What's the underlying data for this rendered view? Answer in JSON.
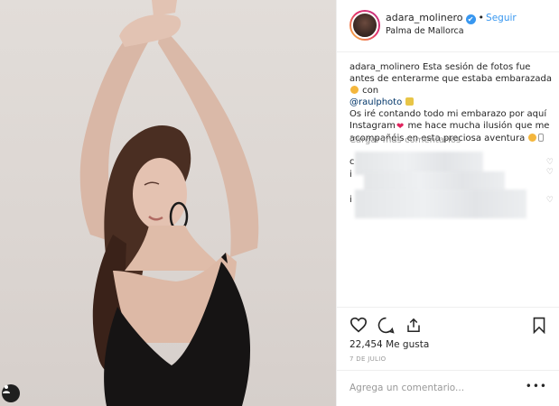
{
  "post": {
    "username": "adara_molinero",
    "verified_glyph": "✔",
    "follow_label": "Seguir",
    "location": "Palma de Mallorca",
    "caption": {
      "line1_user": "adara_molinero",
      "line1_text": " Esta sesión de fotos fue antes de enterarme que estaba embarazada",
      "line1_tail": " con",
      "mention": "@raulphoto",
      "line2": "Os iré contando todo mi embarazo por aquí Instagram",
      "line2_tail": " me hace mucha ilusión que me acompañéis en esta preciosa aventura"
    },
    "load_more": "Cargar más comentarios",
    "comment_letters": [
      "c",
      "i",
      "i"
    ],
    "likes": "22,454 Me gusta",
    "date": "7 DE JULIO",
    "comment_placeholder": "Agrega un comentario...",
    "comment_more": "•••"
  },
  "icons": {
    "like": "heart-outline-icon",
    "comment": "comment-bubble-icon",
    "share": "share-icon",
    "save": "bookmark-icon",
    "tag": "user-tag-icon"
  },
  "colors": {
    "link": "#3897f0",
    "mention": "#003569",
    "border": "#efefef",
    "muted": "#999999"
  }
}
